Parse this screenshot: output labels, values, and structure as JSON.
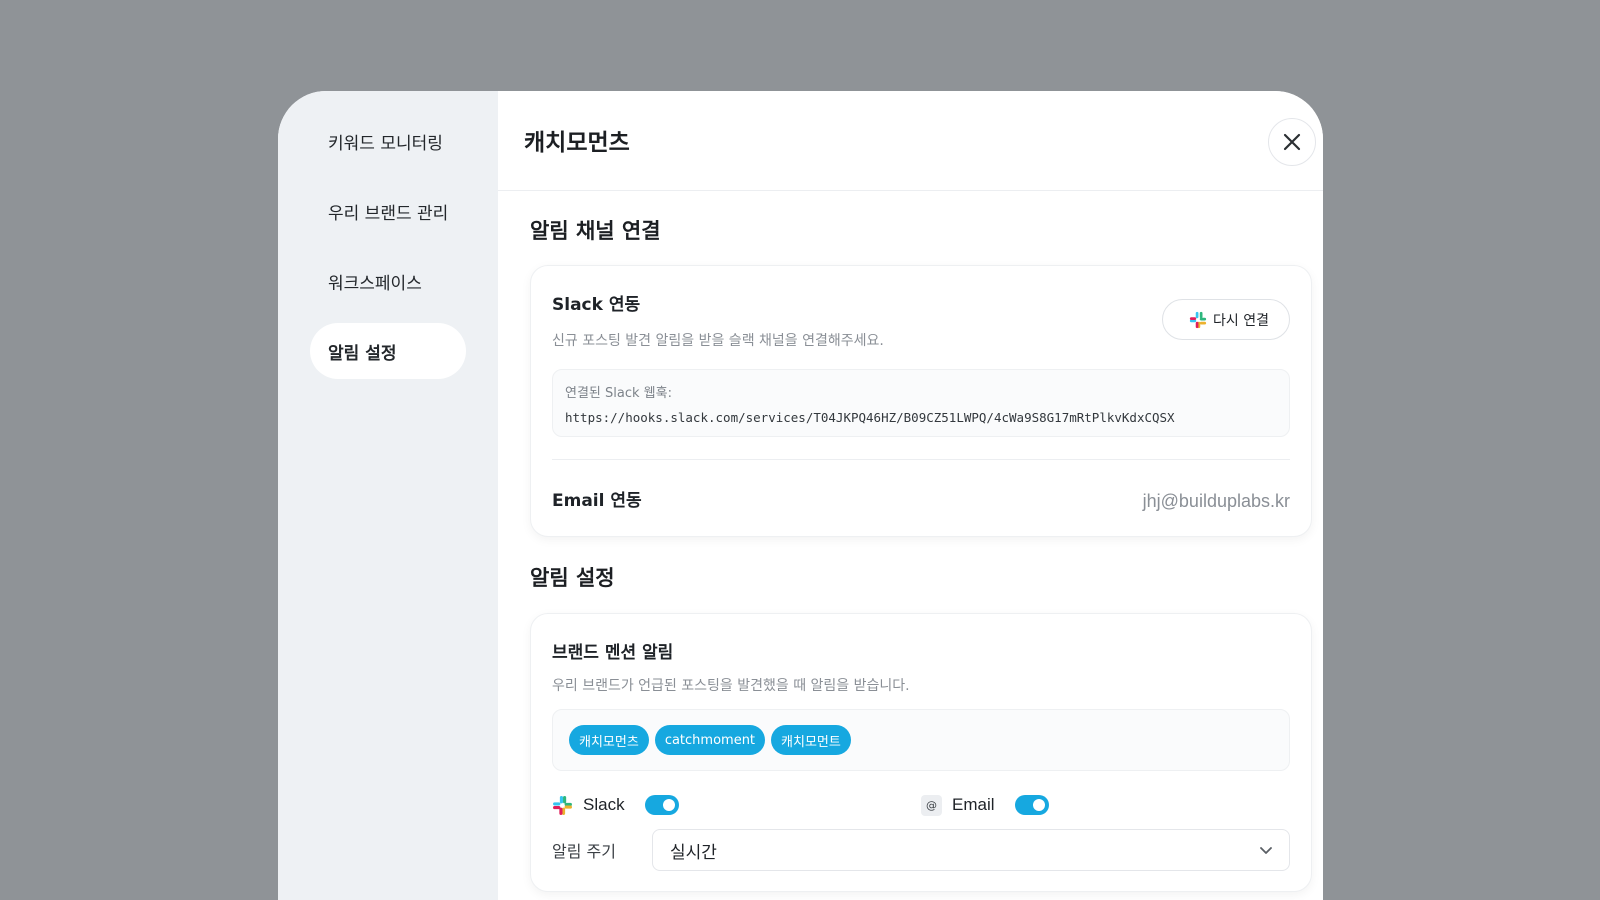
{
  "sidebar": {
    "items": [
      {
        "label": "키워드 모니터링",
        "active": false
      },
      {
        "label": "우리 브랜드 관리",
        "active": false
      },
      {
        "label": "워크스페이스",
        "active": false
      },
      {
        "label": "알림 설정",
        "active": true
      }
    ]
  },
  "header": {
    "title": "캐치모먼츠",
    "close_icon": "close-icon"
  },
  "channels_section": {
    "title": "알림 채널 연결",
    "slack": {
      "heading": "Slack 연동",
      "description": "신규 포스팅 발견 알림을 받을 슬랙 채널을 연결해주세요.",
      "reconnect_label": "다시 연결",
      "webhook_label": "연결된 Slack 웹훅:",
      "webhook_url": "https://hooks.slack.com/services/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"
    },
    "email": {
      "heading": "Email 연동",
      "value": "jhj@builduplabs.kr"
    }
  },
  "alerts_section": {
    "title": "알림 설정",
    "brand_mention": {
      "heading": "브랜드 멘션 알림",
      "description": "우리 브랜드가 언급된 포스팅을 발견했을 때 알림을 받습니다.",
      "tags": [
        "캐치모먼츠",
        "catchmoment",
        "캐치모먼트"
      ],
      "slack_label": "Slack",
      "slack_enabled": true,
      "email_label": "Email",
      "email_enabled": true,
      "email_icon_glyph": "@",
      "frequency_label": "알림 주기",
      "frequency_value": "실시간"
    }
  },
  "colors": {
    "accent": "#16a8e0",
    "backdrop": "#8f9397",
    "sidebar_bg": "#eef1f4"
  }
}
